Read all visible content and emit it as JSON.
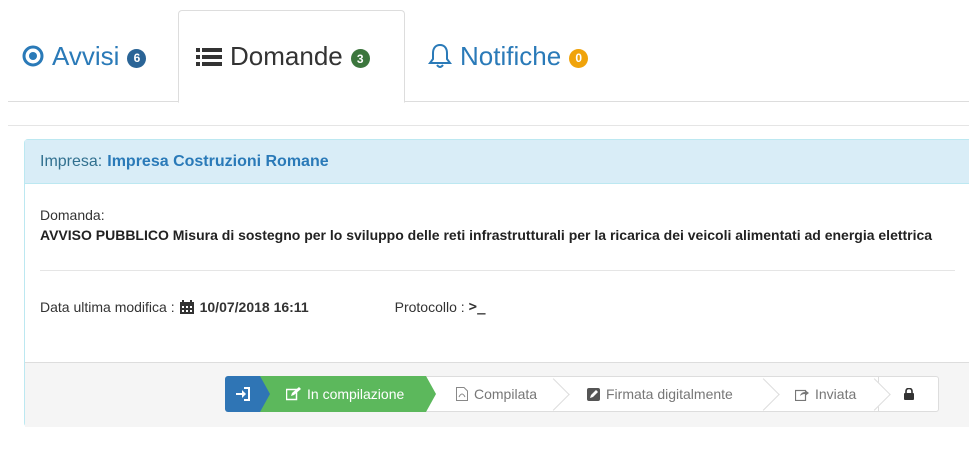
{
  "tabs": [
    {
      "label": "Avvisi",
      "badge": "6",
      "icon": "dot-circle-icon",
      "badge_color": "#2a6496"
    },
    {
      "label": "Domande",
      "badge": "3",
      "icon": "list-icon",
      "badge_color": "#3c763d"
    },
    {
      "label": "Notifiche",
      "badge": "0",
      "icon": "bell-icon",
      "badge_color": "#f0a30a"
    }
  ],
  "panel": {
    "company_label": "Impresa:",
    "company_name": "Impresa Costruzioni Romane",
    "domanda_label": "Domanda:",
    "domanda_title": "AVVISO PUBBLICO Misura di sostegno per lo sviluppo delle reti infrastrutturali per la ricarica dei veicoli alimentati ad energia elettrica",
    "last_modified_label": "Data ultima modifica :",
    "last_modified_value": "10/07/2018 16:11",
    "protocol_label": "Protocollo :",
    "protocol_value": ">_"
  },
  "steps": {
    "current": "In compilazione",
    "compilata": "Compilata",
    "firmata": "Firmata digitalmente",
    "inviata": "Inviata"
  },
  "colors": {
    "link": "#2a7ab8",
    "heading_bg": "#d9edf7",
    "step_current": "#5cb85c",
    "step_login": "#2f75b5"
  }
}
